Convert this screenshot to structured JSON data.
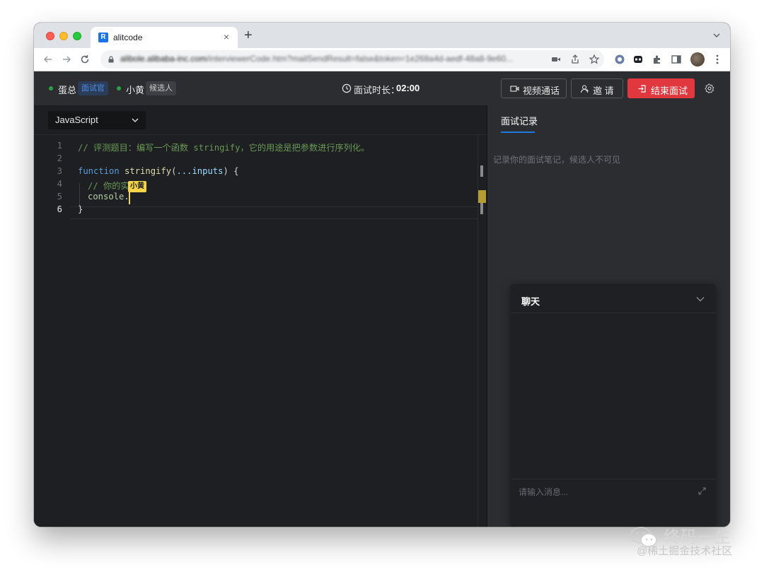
{
  "browser": {
    "tab_title": "alitcode",
    "favicon_letter": "R",
    "new_tab_symbol": "+",
    "close_symbol": "×",
    "url_host": "alibole.alibaba-inc.com",
    "url_rest": "/interviewerCode.htm?mailSendResult=false&token=1e268a4d-aedf-48a8-9e60..."
  },
  "app": {
    "participants": [
      {
        "name": "蛋总",
        "role": "面试官"
      },
      {
        "name": "小黄",
        "role": "候选人"
      }
    ],
    "timer": {
      "label": "面试时长：",
      "value": "02:00"
    },
    "buttons": {
      "video_call": "视频通话",
      "invite": "邀 请",
      "end_interview": "结束面试"
    },
    "colors": {
      "end_button": "#e0383e",
      "accent": "#1f7ae0",
      "online": "#2ea043",
      "cursor_flag": "#f5d547"
    }
  },
  "editor": {
    "language": "JavaScript",
    "line_numbers": [
      "1",
      "2",
      "3",
      "4",
      "5",
      "6"
    ],
    "active_line": 6,
    "lines": {
      "l1": "// 评测题目：编写一个函数 stringify，它的用途是把参数进行序列化。",
      "l3_kw": "function",
      "l3_fn": "stringify",
      "l3_open": "(",
      "l3_params": "...inputs",
      "l3_close": ") {",
      "l4": "// 你的实",
      "l5_obj": "console",
      "l5_dot": ".",
      "l6": "}"
    },
    "remote_cursor_name": "小黄"
  },
  "notes": {
    "tab_label": "面试记录",
    "placeholder": "记录你的面试笔记，候选人不可见"
  },
  "chat": {
    "title": "聊天",
    "input_placeholder": "请输入消息..."
  },
  "watermark": {
    "title": "终码一生",
    "subtitle": "@稀土掘金技术社区"
  }
}
